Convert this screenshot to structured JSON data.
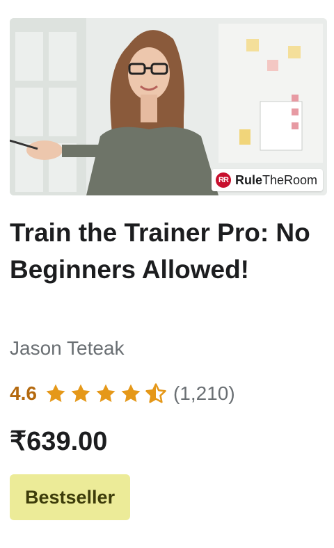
{
  "course": {
    "brand_logo_text_bold": "Rule",
    "brand_logo_text_rest": "TheRoom",
    "brand_logo_mark": "RR",
    "title": "Train the Trainer Pro: No Beginners Allowed!",
    "instructor": "Jason Teteak",
    "rating": "4.6",
    "rating_value": 4.6,
    "rating_max": 5,
    "review_count": "(1,210)",
    "price": "₹639.00",
    "badge": "Bestseller"
  },
  "colors": {
    "rating": "#b4690e",
    "star": "#e59819",
    "badge_bg": "#eceb98",
    "badge_text": "#3d3c0a",
    "muted": "#6a6f73",
    "brand_red": "#c8102e"
  },
  "icons": {
    "star": "star-icon",
    "half_star": "star-half-icon",
    "brand": "ruletheroom-logo-icon"
  }
}
